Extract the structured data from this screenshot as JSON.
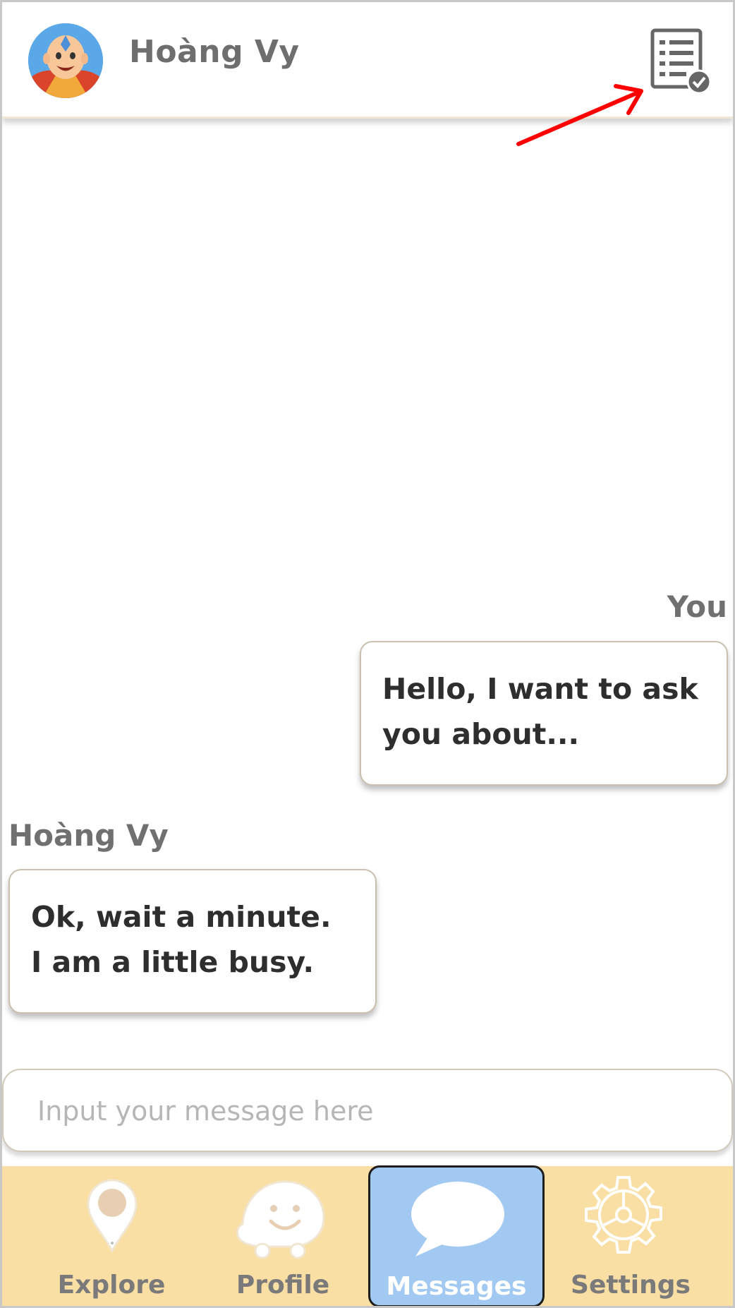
{
  "header": {
    "name": "Hoàng Vy",
    "checklist_icon": "checklist-check-icon"
  },
  "chat": {
    "messages": [
      {
        "sender": "You",
        "lines": [
          "Hello, I want to ask",
          "you about..."
        ]
      },
      {
        "sender": "Hoàng Vy",
        "lines": [
          "Ok, wait a minute.",
          "I am a little busy."
        ]
      }
    ]
  },
  "composer": {
    "placeholder": "Input your message here",
    "value": ""
  },
  "tabs": [
    {
      "label": "Explore",
      "icon": "location-pin-icon"
    },
    {
      "label": "Profile",
      "icon": "smiley-face-icon"
    },
    {
      "label": "Messages",
      "icon": "speech-bubble-icon",
      "active": true
    },
    {
      "label": "Settings",
      "icon": "gear-icon"
    }
  ],
  "colors": {
    "tabbar_bg": "#f9dfa4",
    "active_tab_bg": "#a1c9f1",
    "annotation_arrow": "#ff0000"
  }
}
